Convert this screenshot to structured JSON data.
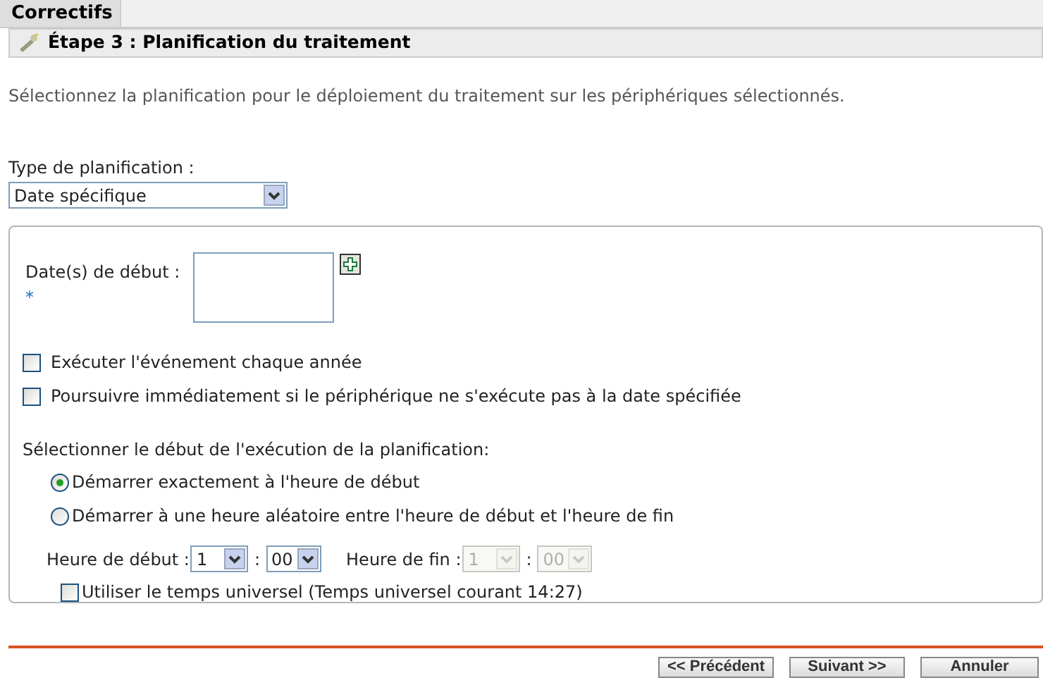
{
  "tabs": [
    {
      "label": "Correctifs",
      "selected": true
    }
  ],
  "step_title": "Étape 3 : Planification du traitement",
  "description": "Sélectionnez la planification pour le déploiement du traitement sur les périphériques sélectionnés.",
  "schedule_type": {
    "label": "Type de planification :",
    "value": "Date spécifique"
  },
  "start_dates": {
    "label": "Date(s) de début :",
    "required_mark": "*"
  },
  "options": [
    {
      "label": "Exécuter l'événement chaque année",
      "checked": false
    },
    {
      "label": "Poursuivre immédiatement si le périphérique ne s'exécute pas à la date spécifiée",
      "checked": false
    }
  ],
  "start_mode": {
    "label": "Sélectionner le début de l'exécution de la planification:",
    "choices": [
      {
        "label": "Démarrer exactement à l'heure de début",
        "selected": true
      },
      {
        "label": "Démarrer à une heure aléatoire entre l'heure de début et l'heure de fin",
        "selected": false
      }
    ]
  },
  "times": [
    {
      "label": "Heure de début :",
      "hour": "1",
      "minute": "00",
      "disabled": false
    },
    {
      "label": "Heure de fin :",
      "hour": "1",
      "minute": "00",
      "disabled": true
    }
  ],
  "separator": ":",
  "utc": {
    "label": "Utiliser le temps universel (Temps universel courant 14:27)",
    "checked": false
  },
  "buttons": [
    "<< Précédent",
    "Suivant >>",
    "Annuler"
  ]
}
